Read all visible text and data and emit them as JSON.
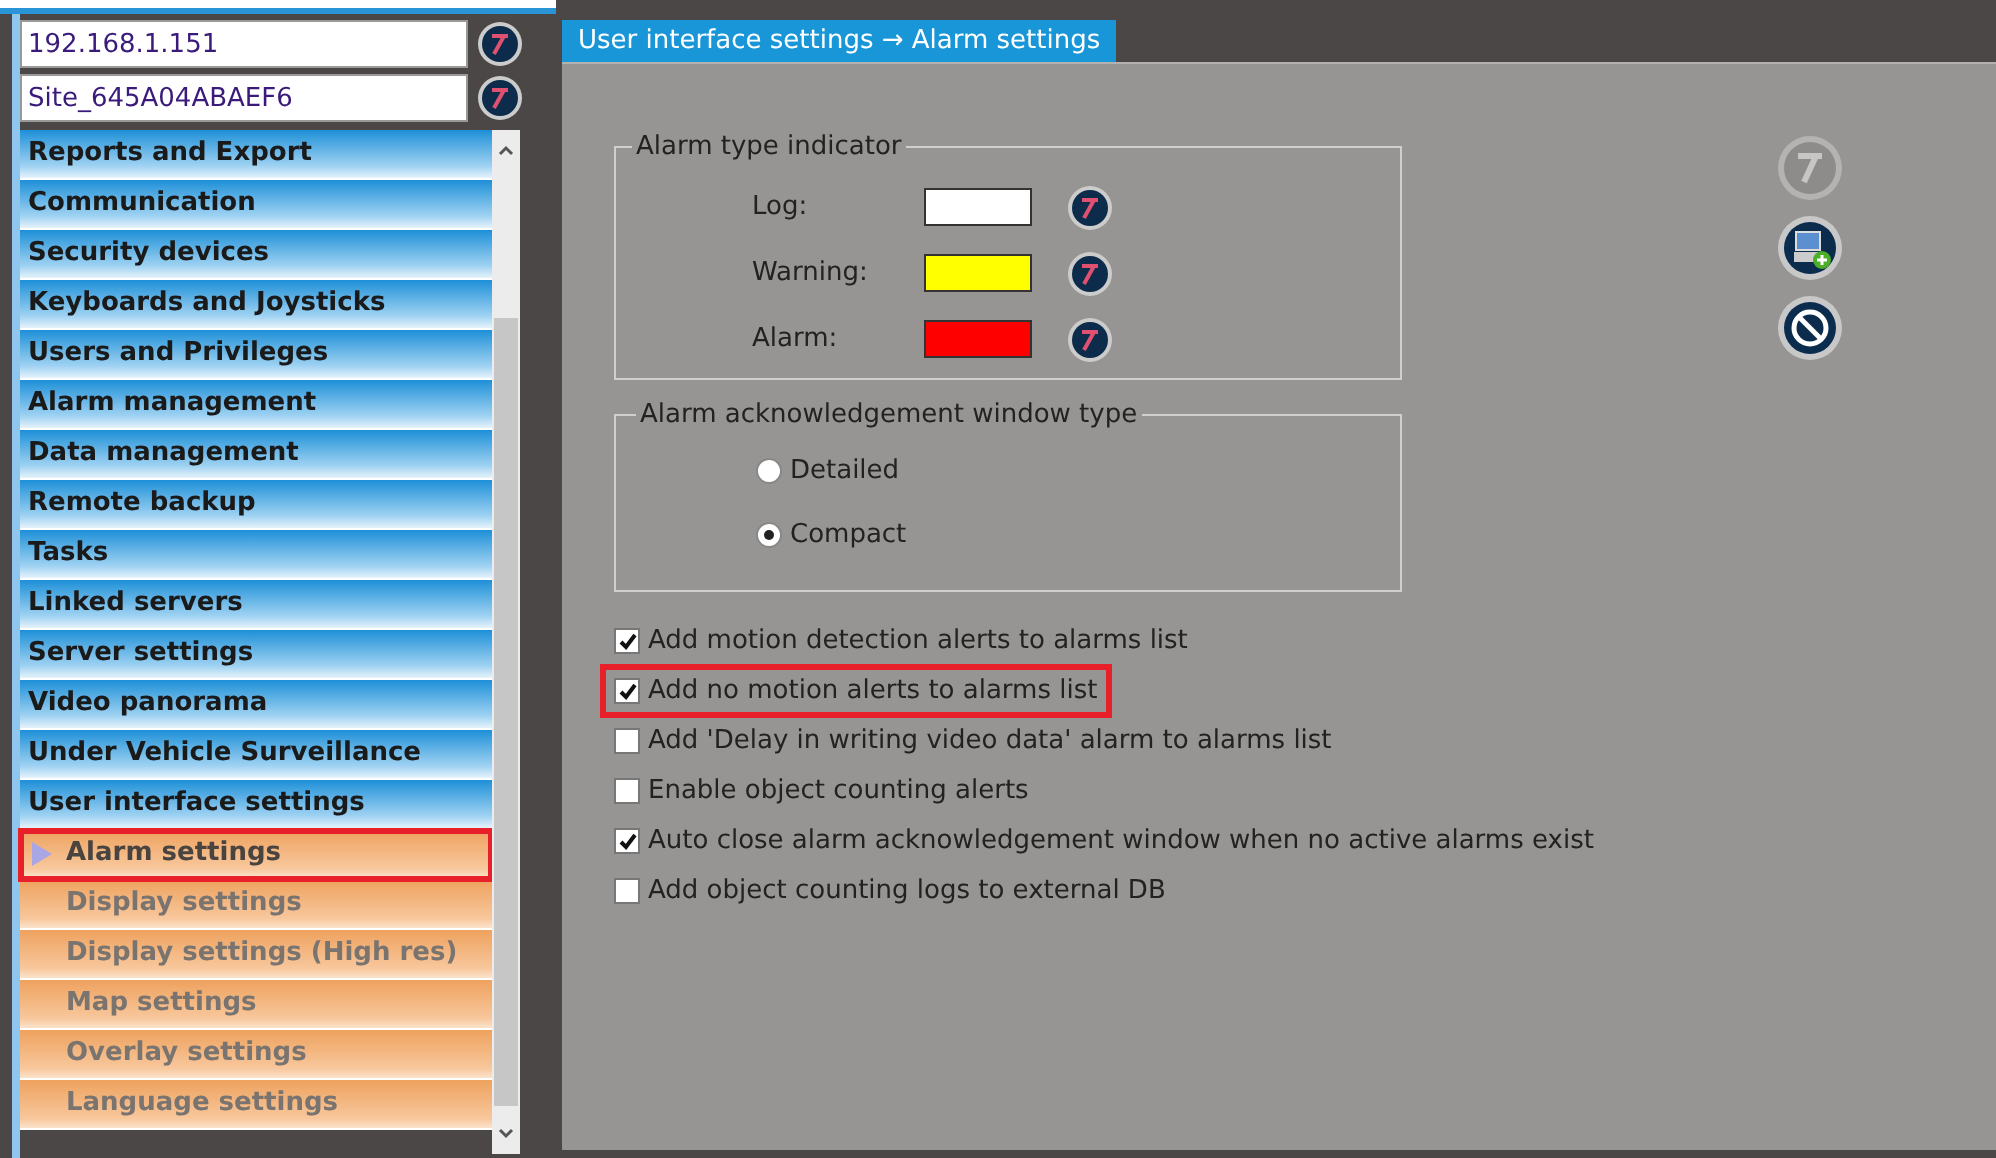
{
  "connection": {
    "address": "192.168.1.151",
    "site": "Site_645A04ABAEF6"
  },
  "menu": {
    "items": [
      {
        "label": "Reports and Export",
        "kind": "section"
      },
      {
        "label": "Communication",
        "kind": "section"
      },
      {
        "label": "Security devices",
        "kind": "section"
      },
      {
        "label": "Keyboards and Joysticks",
        "kind": "section"
      },
      {
        "label": "Users and Privileges",
        "kind": "section"
      },
      {
        "label": "Alarm management",
        "kind": "section"
      },
      {
        "label": "Data management",
        "kind": "section"
      },
      {
        "label": "Remote backup",
        "kind": "section"
      },
      {
        "label": "Tasks",
        "kind": "section"
      },
      {
        "label": "Linked servers",
        "kind": "section"
      },
      {
        "label": "Server settings",
        "kind": "section"
      },
      {
        "label": "Video panorama",
        "kind": "section"
      },
      {
        "label": "Under Vehicle Surveillance",
        "kind": "section"
      },
      {
        "label": "User interface settings",
        "kind": "section"
      },
      {
        "label": "Alarm settings",
        "kind": "page",
        "selected": true,
        "highlighted": true
      },
      {
        "label": "Display settings",
        "kind": "page",
        "selected": false,
        "highlighted": false
      },
      {
        "label": "Display settings (High res)",
        "kind": "page",
        "selected": false,
        "highlighted": false
      },
      {
        "label": "Map settings",
        "kind": "page",
        "selected": false,
        "highlighted": false
      },
      {
        "label": "Overlay settings",
        "kind": "page",
        "selected": false,
        "highlighted": false
      },
      {
        "label": "Language settings",
        "kind": "page",
        "selected": false,
        "highlighted": false
      }
    ]
  },
  "header": {
    "title": "User interface settings → Alarm settings"
  },
  "alarm_type_indicator": {
    "title": "Alarm type indicator",
    "rows": [
      {
        "label": "Log:",
        "color": "#ffffff"
      },
      {
        "label": "Warning:",
        "color": "#ffff00"
      },
      {
        "label": "Alarm:",
        "color": "#ff0000"
      }
    ]
  },
  "ack_window_type": {
    "title": "Alarm acknowledgement window type",
    "options": [
      {
        "label": "Detailed",
        "selected": false
      },
      {
        "label": "Compact",
        "selected": true
      }
    ]
  },
  "options": [
    {
      "label": "Add motion detection alerts to alarms list",
      "checked": true,
      "highlighted": false
    },
    {
      "label": "Add no motion alerts to alarms list",
      "checked": true,
      "highlighted": true
    },
    {
      "label": "Add 'Delay in writing video data' alarm to alarms list",
      "checked": false,
      "highlighted": false
    },
    {
      "label": "Enable object counting alerts",
      "checked": false,
      "highlighted": false
    },
    {
      "label": "Auto close alarm acknowledgement window when no active alarms exist",
      "checked": true,
      "highlighted": false
    },
    {
      "label": "Add object counting logs to external DB",
      "checked": false,
      "highlighted": false
    }
  ],
  "actions": [
    {
      "kind": "help",
      "disabled": true
    },
    {
      "kind": "save",
      "disabled": false
    },
    {
      "kind": "cancel",
      "disabled": false
    }
  ]
}
